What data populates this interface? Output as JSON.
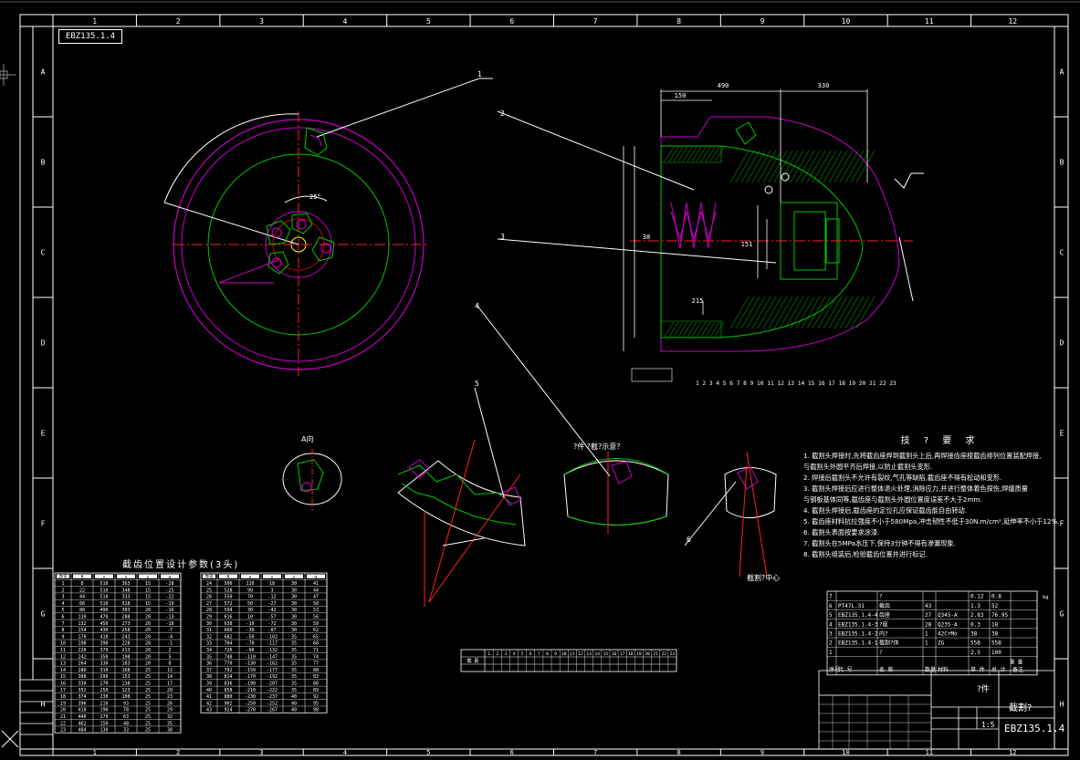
{
  "drawing": {
    "drawing_number": "EBZ135.1.4",
    "part_name": "截割?",
    "component_label": "?件",
    "scale": "1:5",
    "column_labels": [
      "1",
      "2",
      "3",
      "4",
      "5",
      "6",
      "7",
      "8",
      "9",
      "10",
      "11",
      "12"
    ],
    "row_labels": [
      "A",
      "B",
      "C",
      "D",
      "E",
      "F",
      "G",
      "H"
    ],
    "dims": [
      "490",
      "150",
      "330",
      "215",
      "151",
      "38"
    ],
    "callouts": [
      "1",
      "2",
      "3",
      "4",
      "5",
      "6"
    ],
    "pick_numbers": [
      "1",
      "2",
      "3",
      "4",
      "5",
      "6",
      "7",
      "8",
      "9",
      "10",
      "11",
      "12",
      "13",
      "14",
      "15",
      "16",
      "17",
      "18",
      "19",
      "20",
      "21",
      "22",
      "23"
    ],
    "view_labels": {
      "view_a": "A向",
      "view_b": "?件 ?截割?面 ?截?示意?",
      "view_c": "?件 ?截?示意?",
      "center_label": "截割?中心"
    }
  },
  "notes": {
    "title": "技 ? 要 求",
    "lines": [
      "1. 截割头焊接时,先将截齿座焊到截割头上后,再焊接齿座按截齿排列位置装配焊接,",
      "   与截割头外圆平齐后焊接,以防止截割头变形.",
      "2. 焊接后截割头不允许有裂纹,气孔等缺陷,截齿座不得有松动和变形.",
      "3. 截割头焊接后应进行整体退火处理,消除应力,并进行整体着色探伤,焊缝质量",
      "   与钢板基体同等,截齿座与截割头外圆位置度误差不大于2mm.",
      "4. 截割头焊接后,截齿座的定位孔应保证截齿能自由转动.",
      "5. 截齿座材料抗拉强度不小于580Mpa,冲击韧性不低于30N.m/cm²,延伸率不小于12%.",
      "6. 截割头表面按要求涂漆.",
      "7. 截割头在5MPa水压下,保持3分钟不得有渗漏现象.",
      "8. 截割头组装后,检验截齿位置并进行标记."
    ]
  },
  "pick_table": {
    "title": "截齿位置设计参数(3头)",
    "headers": [
      "序号",
      "θ",
      "x",
      "y",
      "z",
      "α"
    ],
    "left_rows": [
      [
        "1",
        "0",
        "510",
        "363",
        "15",
        "-28"
      ],
      [
        "2",
        "22",
        "510",
        "348",
        "15",
        "-25"
      ],
      [
        "3",
        "44",
        "510",
        "333",
        "15",
        "-22"
      ],
      [
        "4",
        "66",
        "510",
        "318",
        "15",
        "-19"
      ],
      [
        "5",
        "88",
        "490",
        "303",
        "20",
        "-16"
      ],
      [
        "6",
        "110",
        "470",
        "288",
        "20",
        "-13"
      ],
      [
        "7",
        "132",
        "450",
        "273",
        "20",
        "-10"
      ],
      [
        "8",
        "154",
        "430",
        "258",
        "20",
        "-7"
      ],
      [
        "9",
        "176",
        "410",
        "243",
        "20",
        "-4"
      ],
      [
        "10",
        "198",
        "390",
        "228",
        "20",
        "-1"
      ],
      [
        "11",
        "220",
        "370",
        "213",
        "20",
        "2"
      ],
      [
        "12",
        "242",
        "350",
        "198",
        "20",
        "5"
      ],
      [
        "13",
        "264",
        "330",
        "183",
        "20",
        "8"
      ],
      [
        "14",
        "286",
        "310",
        "168",
        "25",
        "11"
      ],
      [
        "15",
        "308",
        "290",
        "153",
        "25",
        "14"
      ],
      [
        "16",
        "330",
        "270",
        "138",
        "25",
        "17"
      ],
      [
        "17",
        "352",
        "250",
        "123",
        "25",
        "20"
      ],
      [
        "18",
        "374",
        "230",
        "108",
        "25",
        "23"
      ],
      [
        "19",
        "396",
        "210",
        "93",
        "25",
        "26"
      ],
      [
        "20",
        "418",
        "190",
        "78",
        "25",
        "29"
      ],
      [
        "21",
        "440",
        "170",
        "63",
        "25",
        "32"
      ],
      [
        "22",
        "462",
        "150",
        "48",
        "25",
        "35"
      ],
      [
        "23",
        "484",
        "130",
        "33",
        "25",
        "38"
      ]
    ],
    "right_rows": [
      [
        "24",
        "506",
        "110",
        "18",
        "30",
        "41"
      ],
      [
        "25",
        "528",
        "90",
        "3",
        "30",
        "44"
      ],
      [
        "26",
        "550",
        "70",
        "-12",
        "30",
        "47"
      ],
      [
        "27",
        "572",
        "50",
        "-27",
        "30",
        "50"
      ],
      [
        "28",
        "594",
        "30",
        "-42",
        "30",
        "53"
      ],
      [
        "29",
        "616",
        "10",
        "-57",
        "30",
        "56"
      ],
      [
        "30",
        "638",
        "-10",
        "-72",
        "30",
        "59"
      ],
      [
        "31",
        "660",
        "-30",
        "-87",
        "30",
        "62"
      ],
      [
        "32",
        "682",
        "-50",
        "-102",
        "35",
        "65"
      ],
      [
        "33",
        "704",
        "-70",
        "-117",
        "35",
        "68"
      ],
      [
        "34",
        "726",
        "-90",
        "-132",
        "35",
        "71"
      ],
      [
        "35",
        "748",
        "-110",
        "-147",
        "35",
        "74"
      ],
      [
        "36",
        "770",
        "-130",
        "-162",
        "35",
        "77"
      ],
      [
        "37",
        "792",
        "-150",
        "-177",
        "35",
        "80"
      ],
      [
        "38",
        "814",
        "-170",
        "-192",
        "35",
        "83"
      ],
      [
        "39",
        "836",
        "-190",
        "-207",
        "35",
        "86"
      ],
      [
        "40",
        "858",
        "-210",
        "-222",
        "35",
        "89"
      ],
      [
        "41",
        "880",
        "-230",
        "-237",
        "40",
        "92"
      ],
      [
        "42",
        "902",
        "-250",
        "-252",
        "40",
        "95"
      ],
      [
        "43",
        "924",
        "-270",
        "-267",
        "40",
        "98"
      ]
    ]
  },
  "bom": {
    "rows": [
      [
        "7",
        "",
        "?",
        "",
        "",
        "0.12",
        "0.8"
      ],
      [
        "6",
        "PT47L.31",
        "截齿",
        "43",
        "",
        "1.3",
        "52"
      ],
      [
        "5",
        "EBZ135.1.4-4",
        "齿座",
        "27",
        "Q345-A",
        "2.83",
        "76.95"
      ],
      [
        "4",
        "EBZ135.1.4-3",
        "?座",
        "28",
        "Q235-A",
        "0.3",
        "18"
      ],
      [
        "3",
        "EBZ135.1.4-2",
        "内?",
        "1",
        "42CrMo",
        "38",
        "38"
      ],
      [
        "2",
        "EBZ135.1.4-1",
        "截割?体",
        "1",
        "ZG",
        "558",
        "558"
      ],
      [
        "1",
        "",
        "?",
        "",
        "",
        "2.5",
        "100"
      ]
    ],
    "header": [
      "序号",
      "代 号",
      "名 称",
      "数量",
      "材料",
      "单 件",
      "总 计",
      "备注"
    ],
    "unit_label": "重 量",
    "mass_unit": "kg"
  },
  "small_table": {
    "headers": [
      "1",
      "2",
      "3",
      "4",
      "5",
      "6",
      "7",
      "8",
      "9",
      "10",
      "11",
      "12",
      "13",
      "14",
      "15",
      "16",
      "17",
      "18",
      "19",
      "20",
      "21",
      "22",
      "23"
    ],
    "row_label": "截 距"
  }
}
